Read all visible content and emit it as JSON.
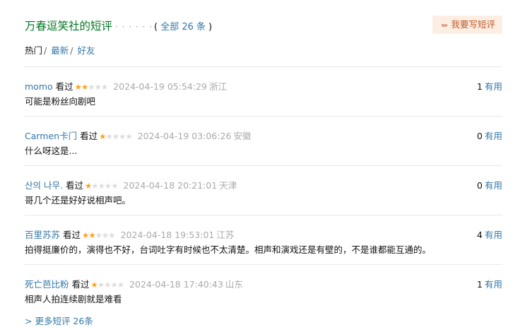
{
  "header": {
    "title": "万春逗笑社的短评",
    "dots": "· · · · · ·",
    "count_open": "( ",
    "count_label": "全部 26 条",
    "count_close": " )",
    "write_button": "我要写短评"
  },
  "tabs": [
    {
      "label": "热门",
      "sep": "/"
    },
    {
      "label": "最新",
      "sep": "/"
    },
    {
      "label": "好友",
      "sep": ""
    }
  ],
  "useful_label": "有用",
  "watched_label": "看过",
  "reviews": [
    {
      "user": "momo",
      "rating": 2,
      "time": "2024-04-19 05:54:29",
      "location": "浙江",
      "useful": "1",
      "content": "可能是粉丝向剧吧"
    },
    {
      "user": "Carmen卡门",
      "rating": 1,
      "time": "2024-04-19 03:06:26",
      "location": "安徽",
      "useful": "0",
      "content": "什么呀这是..."
    },
    {
      "user": "산의 나무.",
      "rating": 1,
      "time": "2024-04-18 20:21:01",
      "location": "天津",
      "useful": "0",
      "content": "哥几个还是好好说相声吧。"
    },
    {
      "user": "百里苏苏",
      "rating": 2,
      "time": "2024-04-18 19:53:01",
      "location": "江苏",
      "useful": "4",
      "content": "拍得挺廉价的，演得也不好，台词吐字有时候也不太清楚。相声和演戏还是有壁的，不是谁都能互通的。"
    },
    {
      "user": "死亡芭比粉",
      "rating": 1,
      "time": "2024-04-18 17:40:43",
      "location": "山东",
      "useful": "1",
      "content": "相声人拍连续剧就是难看"
    }
  ],
  "more_link": "> 更多短评 26条",
  "colors": {
    "link": "#3377aa",
    "title": "#007722",
    "star": "#f5a623",
    "button_bg": "#fdeee4",
    "button_text": "#c05a2a"
  },
  "icons": {
    "write": "pencil-icon",
    "star": "star-icon"
  }
}
